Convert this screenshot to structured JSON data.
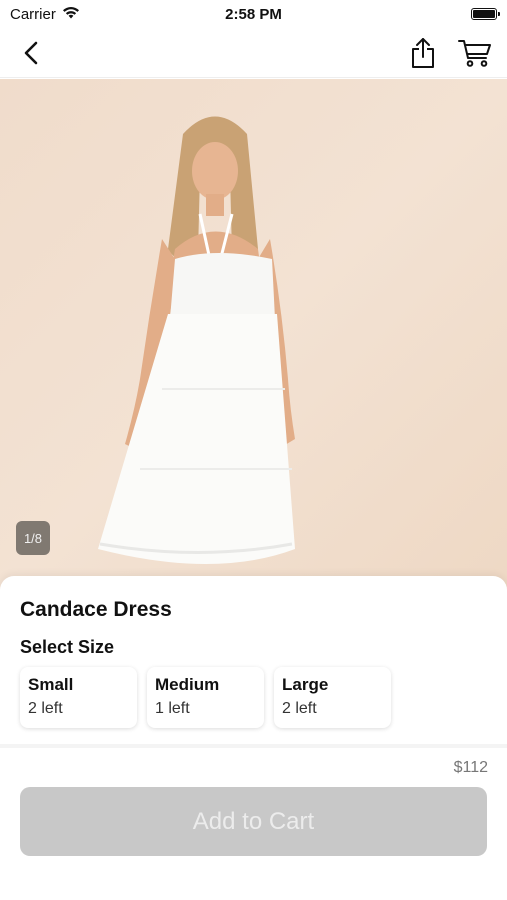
{
  "status_bar": {
    "carrier": "Carrier",
    "time": "2:58 PM"
  },
  "nav": {
    "back_icon": "chevron-left-icon",
    "share_icon": "share-icon",
    "cart_icon": "cart-icon"
  },
  "product": {
    "image_counter": "1/8",
    "title": "Candace Dress",
    "select_size_label": "Select Size",
    "sizes": [
      {
        "name": "Small",
        "stock": "2 left"
      },
      {
        "name": "Medium",
        "stock": "1 left"
      },
      {
        "name": "Large",
        "stock": "2 left"
      }
    ],
    "price": "$112",
    "add_to_cart_label": "Add to Cart"
  },
  "colors": {
    "add_to_cart_disabled_bg": "#c8c8c8",
    "image_background": "#f0dccb"
  }
}
